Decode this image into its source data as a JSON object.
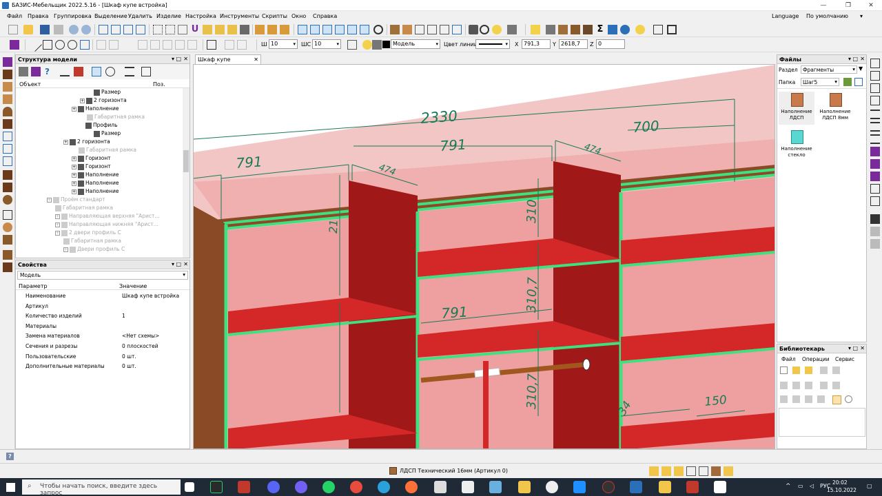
{
  "window": {
    "title": "БАЗИС-Мебельщик 2022.5.16 - [Шкаф купе встройка]",
    "minimize": "—",
    "restore": "❐",
    "close": "✕"
  },
  "menu": {
    "items": [
      "Файл",
      "Правка",
      "Группировка",
      "Выделение",
      "Удалить",
      "Изделие",
      "Настройка",
      "Инструменты",
      "Скрипты",
      "Окно",
      "Справка"
    ],
    "language": "Language",
    "default": "По умолчанию"
  },
  "toolbar2": {
    "w_label": "Ш",
    "w_value": "10",
    "ws_label": "ШС",
    "ws_value": "10",
    "layer_value": "Модель",
    "line_color_label": "Цвет линии",
    "x_label": "X",
    "x_value": "791,3",
    "y_label": "Y",
    "y_value": "2618,7",
    "z_label": "Z",
    "z_value": "0"
  },
  "model_tree": {
    "title": "Структура модели",
    "col_object": "Объект",
    "col_pos": "Поз.",
    "rows": [
      {
        "label": "Размер",
        "dim": false
      },
      {
        "label": "2 горизонта",
        "dim": false
      },
      {
        "label": "Наполнение",
        "dim": false
      },
      {
        "label": "Габаритная рамка",
        "dim": true
      },
      {
        "label": "Профиль",
        "dim": false
      },
      {
        "label": "Размер",
        "dim": false
      },
      {
        "label": "2 горизонта",
        "dim": false
      },
      {
        "label": "Габаритная рамка",
        "dim": true
      },
      {
        "label": "Горизонт",
        "dim": false
      },
      {
        "label": "Горизонт",
        "dim": false
      },
      {
        "label": "Наполнение",
        "dim": false
      },
      {
        "label": "Наполнение",
        "dim": false
      },
      {
        "label": "Наполнение",
        "dim": false
      },
      {
        "label": "Проём стандарт",
        "dim": true
      },
      {
        "label": "Габаритная рамка",
        "dim": true
      },
      {
        "label": "Направляющая верхняя \"Арист...",
        "dim": true
      },
      {
        "label": "Направляющая нижняя \"Арист...",
        "dim": true
      },
      {
        "label": "2 двери профиль С",
        "dim": true
      },
      {
        "label": "Габаритная рамка",
        "dim": true
      },
      {
        "label": "Двери профиль С",
        "dim": true
      }
    ]
  },
  "properties": {
    "title": "Свойства",
    "selector": "Модель",
    "col_param": "Параметр",
    "col_value": "Значение",
    "rows": [
      {
        "name": "Наименование",
        "value": "Шкаф купе встройка"
      },
      {
        "name": "Артикул",
        "value": ""
      },
      {
        "name": "Количество изделий",
        "value": "1"
      },
      {
        "name": "Материалы",
        "value": ""
      },
      {
        "name": "Замена материалов",
        "value": "<Нет схемы>"
      },
      {
        "name": "Сечения и разрезы",
        "value": "0 плоскостей"
      },
      {
        "name": "Пользовательские",
        "value": "0 шт."
      },
      {
        "name": "Дополнительные материалы",
        "value": "0 шт."
      }
    ]
  },
  "viewport": {
    "tab": "Шкаф купе встройка",
    "dimensions": [
      "2330",
      "791",
      "700",
      "791",
      "474",
      "474",
      "791",
      "310",
      "310,7",
      "310,7",
      "150",
      "34",
      "21"
    ]
  },
  "files_panel": {
    "title": "Файлы",
    "section_label": "Раздел",
    "section_value": "Фрагменты",
    "folder_label": "Папка",
    "folder_value": "Шаг5",
    "items": [
      {
        "label_line1": "Наполнение",
        "label_line2": "ЛДСП",
        "color": "#c87a4a"
      },
      {
        "label_line1": "Наполнение",
        "label_line2": "ЛДСП 8мм",
        "color": "#c87a4a"
      },
      {
        "label_line1": "Наполнение",
        "label_line2": "стекло",
        "color": "#58d8d0"
      }
    ]
  },
  "librarian": {
    "title": "Библиотекарь",
    "menu": [
      "Файл",
      "Операции",
      "Сервис"
    ]
  },
  "status": {
    "material": "ЛДСП Технический 16мм (Артикул 0)"
  },
  "taskbar": {
    "search_placeholder": "Чтобы начать поиск, введите здесь запрос",
    "lang": "РУС",
    "time": "20:02",
    "date": "15.10.2022"
  }
}
